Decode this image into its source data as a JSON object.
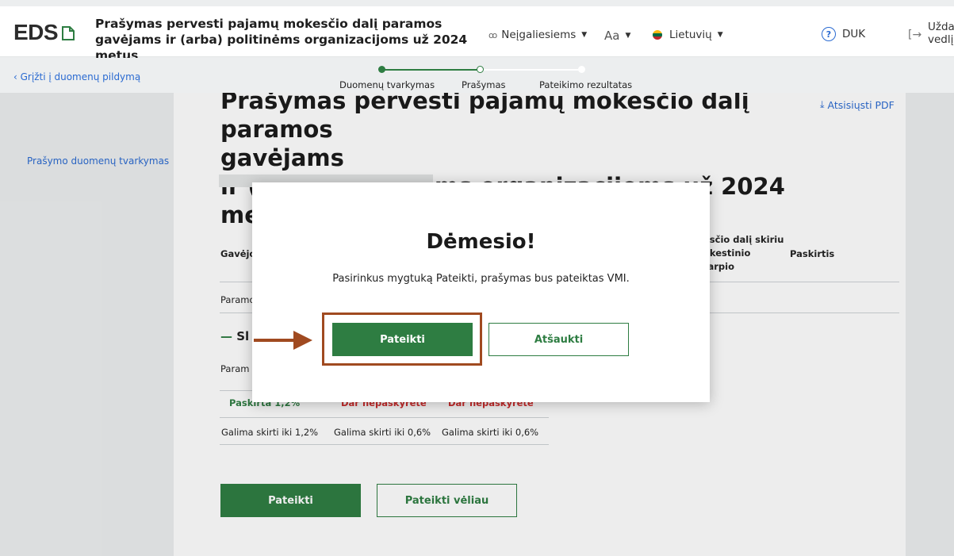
{
  "header": {
    "logo": "EDS",
    "title": "Prašymas pervesti pajamų mokesčio dalį paramos gavėjams ir (arba) politinėms organizacijoms už 2024 metus",
    "accessibility_label": "Neįgaliesiems",
    "font_size_label": "Aa",
    "language_label": "Lietuvių",
    "help_label": "DUK",
    "close_label": "Uždaryti vedlį"
  },
  "progress": {
    "back_link": "Grįžti į duomenų pildymą",
    "steps": [
      {
        "label": "Duomenų tvarkymas",
        "state": "done"
      },
      {
        "label": "Prašymas",
        "state": "current"
      },
      {
        "label": "Pateikimo rezultatas",
        "state": "pending"
      }
    ]
  },
  "sidebar": {
    "link": "Prašymo duomenų tvarkymas"
  },
  "main": {
    "title_line1": "Prašymas pervesti pajamų mokesčio dalį paramos",
    "title_line2": "gavėjams",
    "title_line3": "ir (arba) politinėms organizacijoms už 2024 metus",
    "pdf_link": "Atsisiųsti PDF",
    "table": {
      "col_recipient": "Gavėjo",
      "col_share_l1": "esčio dalį skiriu",
      "col_share_l2": "okestinio",
      "col_share_l3": "tarpio",
      "col_purpose": "Paskirtis",
      "row1_text": "Paramo",
      "section_text": "Sl",
      "row2_text": "Param",
      "summary": {
        "assigned": "Paskirta 1,2%",
        "not_assigned_1": "Dar nepaskyrėte",
        "not_assigned_2": "Dar nepaskyrėte",
        "limit_1": "Galima skirti iki 1,2%",
        "limit_2": "Galima skirti iki 0,6%",
        "limit_3": "Galima skirti iki 0,6%"
      }
    },
    "submit_label": "Pateikti",
    "submit_later_label": "Pateikti vėliau"
  },
  "modal": {
    "title": "Dėmesio!",
    "text": "Pasirinkus mygtuką Pateikti, prašymas bus pateiktas VMI.",
    "confirm_label": "Pateikti",
    "cancel_label": "Atšaukti"
  },
  "colors": {
    "primary_green": "#2e7d42",
    "link_blue": "#2a6ad1",
    "annotation_brown": "#a04a20",
    "error_red": "#d02b2b"
  }
}
